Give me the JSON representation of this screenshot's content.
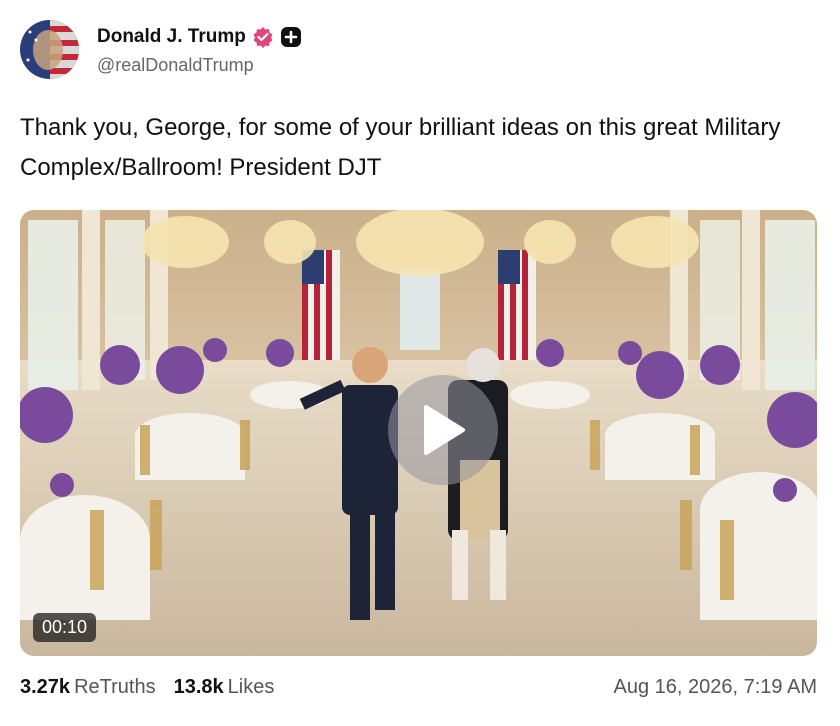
{
  "post": {
    "display_name": "Donald J. Trump",
    "handle": "@realDonaldTrump",
    "text": "Thank you, George, for some of your brilliant ideas on this great Military Complex/Ballroom! President DJT",
    "badges": [
      "verified-badge-icon",
      "plus-badge-icon"
    ],
    "accent_color": "#e0457b"
  },
  "media": {
    "type": "video",
    "duration": "00:10",
    "play_icon": "play-icon"
  },
  "stats": {
    "retruths_count": "3.27k",
    "retruths_label": "ReTruths",
    "likes_count": "13.8k",
    "likes_label": "Likes"
  },
  "timestamp": "Aug 16, 2026, 7:19 AM"
}
